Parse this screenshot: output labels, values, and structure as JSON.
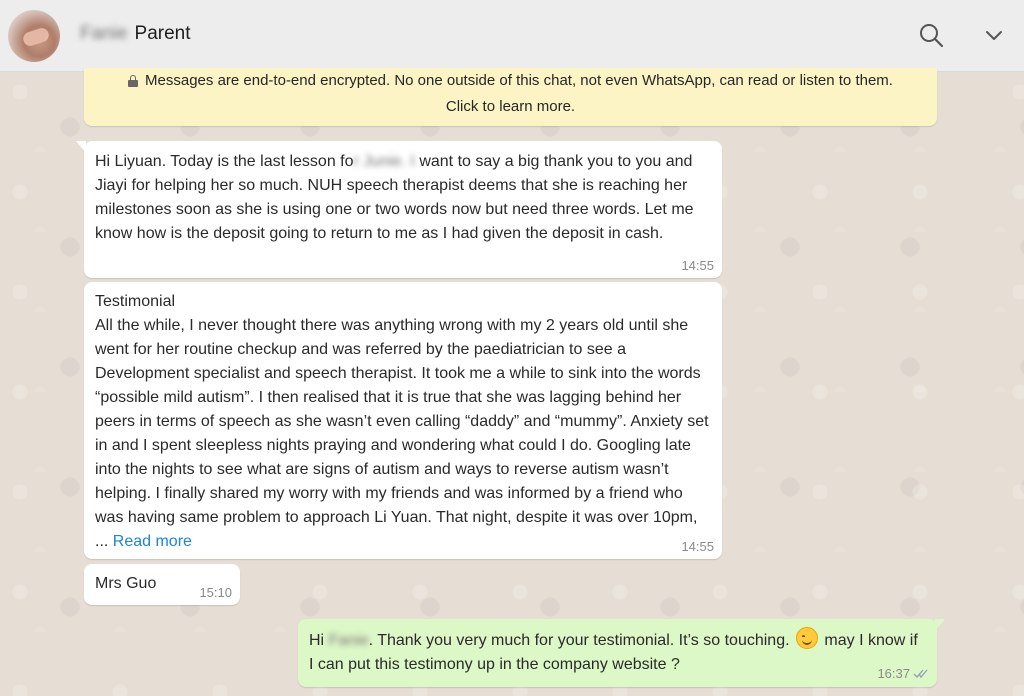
{
  "header": {
    "contact_blurred": "Fanie",
    "contact_name": "Parent"
  },
  "notice": {
    "line1": "Messages are end-to-end encrypted. No one outside of this chat, not even WhatsApp, can read or listen to them.",
    "line2": "Click to learn more."
  },
  "messages": [
    {
      "direction": "incoming",
      "text_before": "Hi Liyuan. Today is the last lesson fo",
      "blurred": "r Junie. I",
      "text_after": " want to say a big thank you to you and Jiayi for helping her so much. NUH speech therapist deems that she is reaching her milestones soon as she is using one or two words now but need three words. Let me know how is the deposit going to return to me as I had given the deposit in cash.",
      "time": "14:55"
    },
    {
      "direction": "incoming",
      "text": "Testimonial\nAll the while, I never thought there was anything wrong with my 2 years old until she went for her routine checkup and was referred by the paediatrician to see a Development specialist and speech therapist. It took me a while to sink into the words “possible mild autism”. I then realised that it is true that she was lagging behind her peers in terms of speech as she wasn’t even calling “daddy” and “mummy”. Anxiety set in and I spent sleepless nights praying and wondering what could I do. Googling late into the nights to see what are signs of autism and ways to reverse autism wasn’t helping. I finally shared my worry with my friends and was informed by a friend who was having same problem to approach Li Yuan. That night, despite it was over 10pm, ... ",
      "read_more": "Read more",
      "time": "14:55"
    },
    {
      "direction": "incoming",
      "text": "Mrs Guo",
      "time": "15:10"
    },
    {
      "direction": "outgoing",
      "text_before": "Hi ",
      "blurred": "Fanie",
      "text_after": ". Thank you very much for your testimonial. It’s so touching. ",
      "emoji": "smiling-face-icon",
      "text_end": " may I know if I can put this testimony up in the company website ?",
      "time": "16:37",
      "status": "read-double-tick-icon"
    }
  ],
  "colors": {
    "header_bg": "#ededed",
    "wallpaper": "#e6ded5",
    "notice_bg": "#fcf4c4",
    "incoming_bubble": "#ffffff",
    "outgoing_bubble": "#dcf8c6",
    "link": "#1a86d9"
  }
}
